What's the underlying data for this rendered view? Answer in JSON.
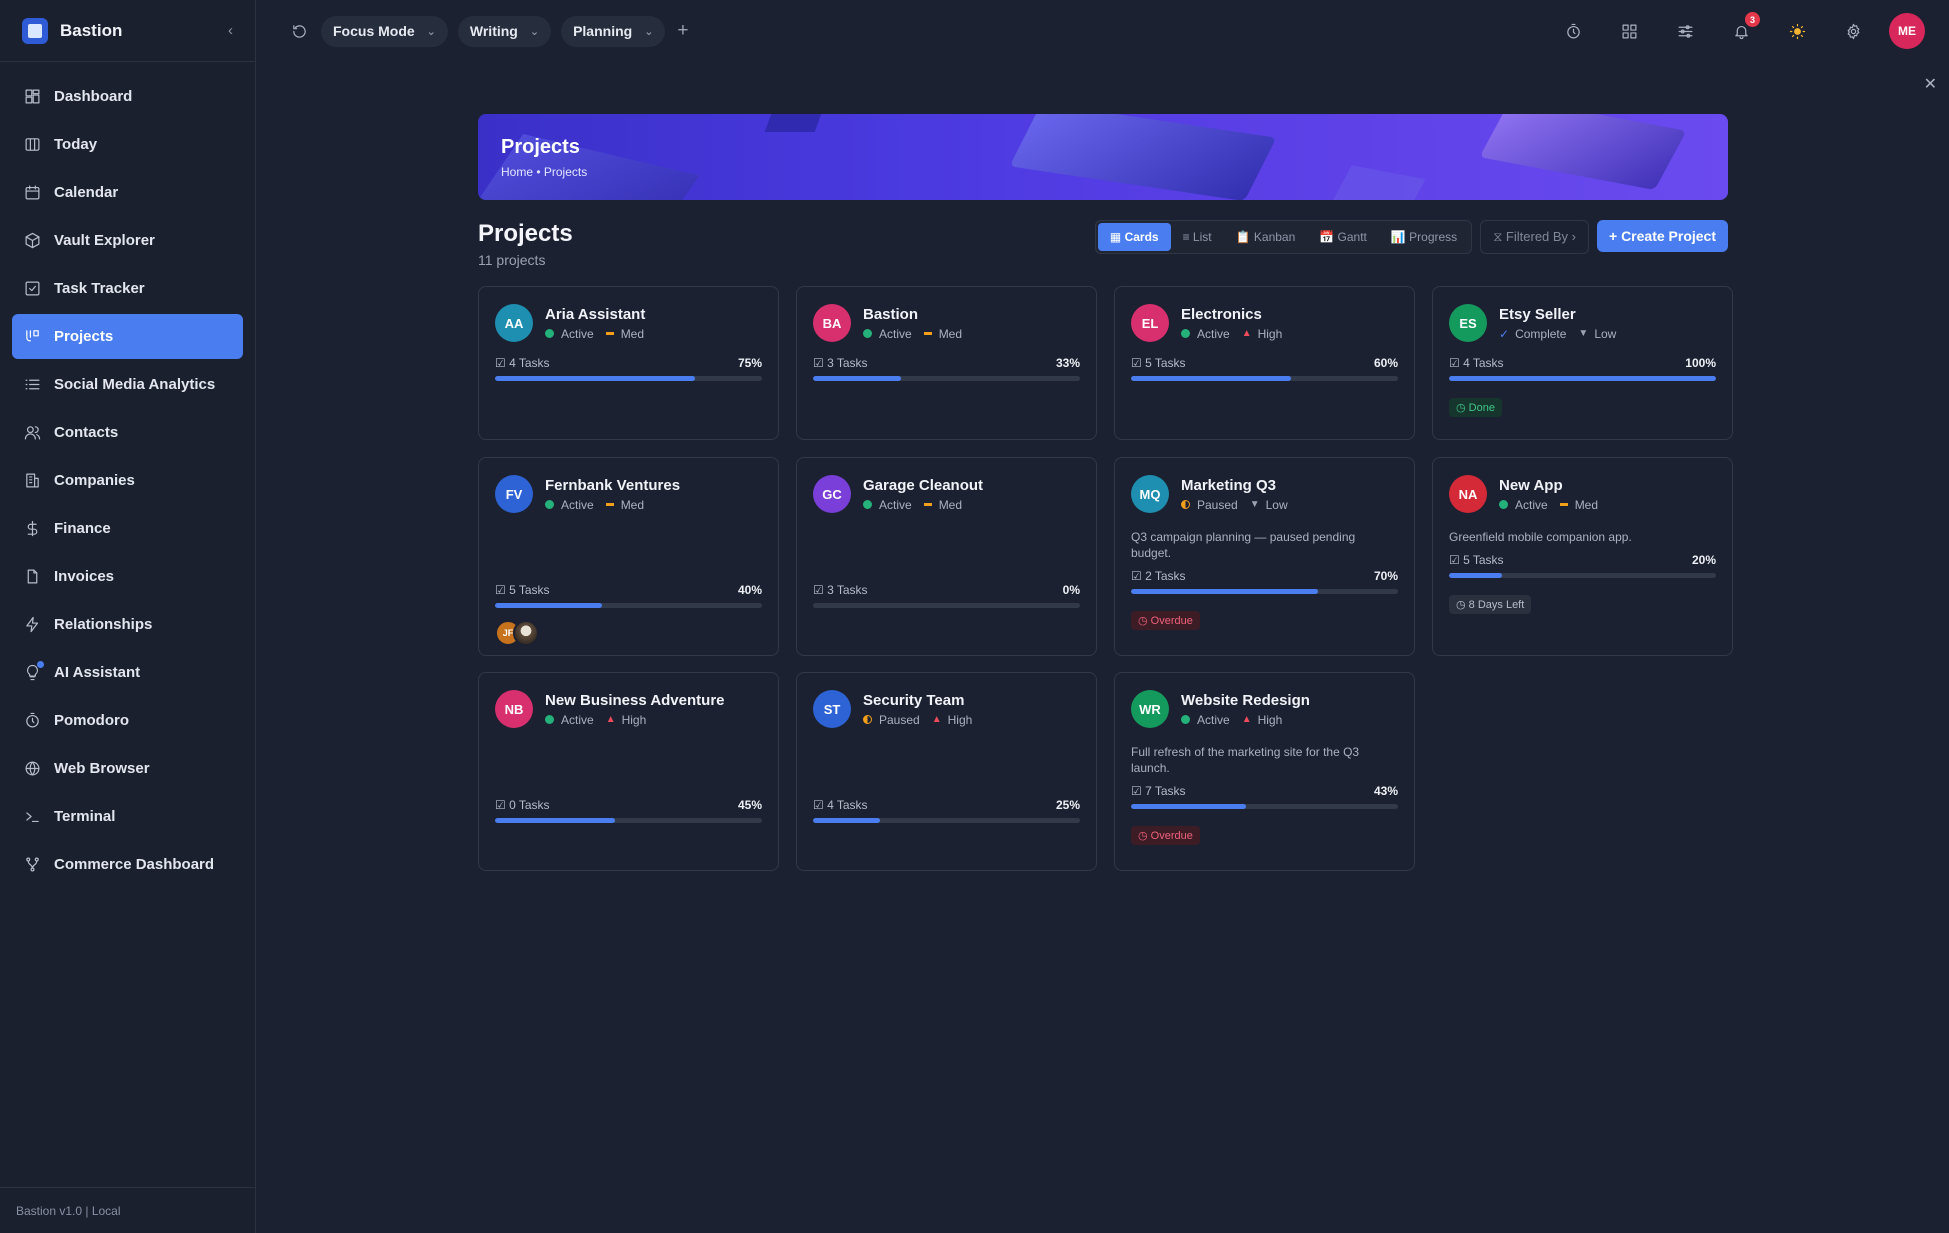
{
  "app": {
    "name": "Bastion",
    "version_label": "Bastion v1.0 | Local"
  },
  "sidebar": {
    "items": [
      {
        "label": "Dashboard",
        "icon": "dashboard-icon"
      },
      {
        "label": "Today",
        "icon": "columns-icon"
      },
      {
        "label": "Calendar",
        "icon": "calendar-icon"
      },
      {
        "label": "Vault Explorer",
        "icon": "cube-icon"
      },
      {
        "label": "Task Tracker",
        "icon": "checkbox-icon"
      },
      {
        "label": "Projects",
        "icon": "projects-icon",
        "active": true
      },
      {
        "label": "Social Media Analytics",
        "icon": "list-icon"
      },
      {
        "label": "Contacts",
        "icon": "users-icon"
      },
      {
        "label": "Companies",
        "icon": "building-icon"
      },
      {
        "label": "Finance",
        "icon": "dollar-icon"
      },
      {
        "label": "Invoices",
        "icon": "file-icon"
      },
      {
        "label": "Relationships",
        "icon": "bolt-icon"
      },
      {
        "label": "AI Assistant",
        "icon": "bulb-icon"
      },
      {
        "label": "Pomodoro",
        "icon": "timer-icon"
      },
      {
        "label": "Web Browser",
        "icon": "globe-icon"
      },
      {
        "label": "Terminal",
        "icon": "terminal-icon"
      },
      {
        "label": "Commerce Dashboard",
        "icon": "branch-icon"
      }
    ]
  },
  "topbar": {
    "tabs": [
      {
        "label": "Focus Mode"
      },
      {
        "label": "Writing"
      },
      {
        "label": "Planning"
      }
    ],
    "notification_count": "3",
    "user_initials": "ME"
  },
  "banner": {
    "title": "Projects",
    "breadcrumb": "Home • Projects"
  },
  "page": {
    "title": "Projects",
    "subtitle": "11 projects",
    "views": [
      "▦ Cards",
      "≡ List",
      "📋 Kanban",
      "📅 Gantt",
      "📊 Progress"
    ],
    "filter_label": "⧖ Filtered By ›",
    "create_label": "+ Create Project"
  },
  "projects": [
    {
      "initials": "AA",
      "name": "Aria Assistant",
      "status": "Active",
      "priority": "Med",
      "tasks": "4 Tasks",
      "progress": 75,
      "progress_label": "75%",
      "color": "#1e8fb0"
    },
    {
      "initials": "BA",
      "name": "Bastion",
      "status": "Active",
      "priority": "Med",
      "tasks": "3 Tasks",
      "progress": 33,
      "progress_label": "33%",
      "color": "#d8306e"
    },
    {
      "initials": "EL",
      "name": "Electronics",
      "status": "Active",
      "priority": "High",
      "tasks": "5 Tasks",
      "progress": 60,
      "progress_label": "60%",
      "color": "#d8306e"
    },
    {
      "initials": "ES",
      "name": "Etsy Seller",
      "status": "Complete",
      "priority": "Low",
      "tasks": "4 Tasks",
      "progress": 100,
      "progress_label": "100%",
      "color": "#159a5e",
      "tag": "Done"
    },
    {
      "initials": "FV",
      "name": "Fernbank Ventures",
      "status": "Active",
      "priority": "Med",
      "tasks": "5 Tasks",
      "progress": 40,
      "progress_label": "40%",
      "color": "#2e63d6",
      "members": [
        "JF",
        ""
      ]
    },
    {
      "initials": "GC",
      "name": "Garage Cleanout",
      "status": "Active",
      "priority": "Med",
      "tasks": "3 Tasks",
      "progress": 0,
      "progress_label": "0%",
      "color": "#7a3fd8"
    },
    {
      "initials": "MQ",
      "name": "Marketing Q3",
      "status": "Paused",
      "priority": "Low",
      "description": "Q3 campaign planning — paused pending budget.",
      "tasks": "2 Tasks",
      "progress": 70,
      "progress_label": "70%",
      "color": "#1e8fb0",
      "tag": "Overdue"
    },
    {
      "initials": "NA",
      "name": "New App",
      "status": "Active",
      "priority": "Med",
      "description": "Greenfield mobile companion app.",
      "tasks": "5 Tasks",
      "progress": 20,
      "progress_label": "20%",
      "color": "#d42a38",
      "tag": "8 Days Left"
    },
    {
      "initials": "NB",
      "name": "New Business Adventure",
      "status": "Active",
      "priority": "High",
      "tasks": "0 Tasks",
      "progress": 45,
      "progress_label": "45%",
      "color": "#d8306e"
    },
    {
      "initials": "ST",
      "name": "Security Team",
      "status": "Paused",
      "priority": "High",
      "tasks": "4 Tasks",
      "progress": 25,
      "progress_label": "25%",
      "color": "#2e63d6"
    },
    {
      "initials": "WR",
      "name": "Website Redesign",
      "status": "Active",
      "priority": "High",
      "description": "Full refresh of the marketing site for the Q3 launch.",
      "tasks": "7 Tasks",
      "progress": 43,
      "progress_label": "43%",
      "color": "#159a5e",
      "tag": "Overdue"
    }
  ]
}
